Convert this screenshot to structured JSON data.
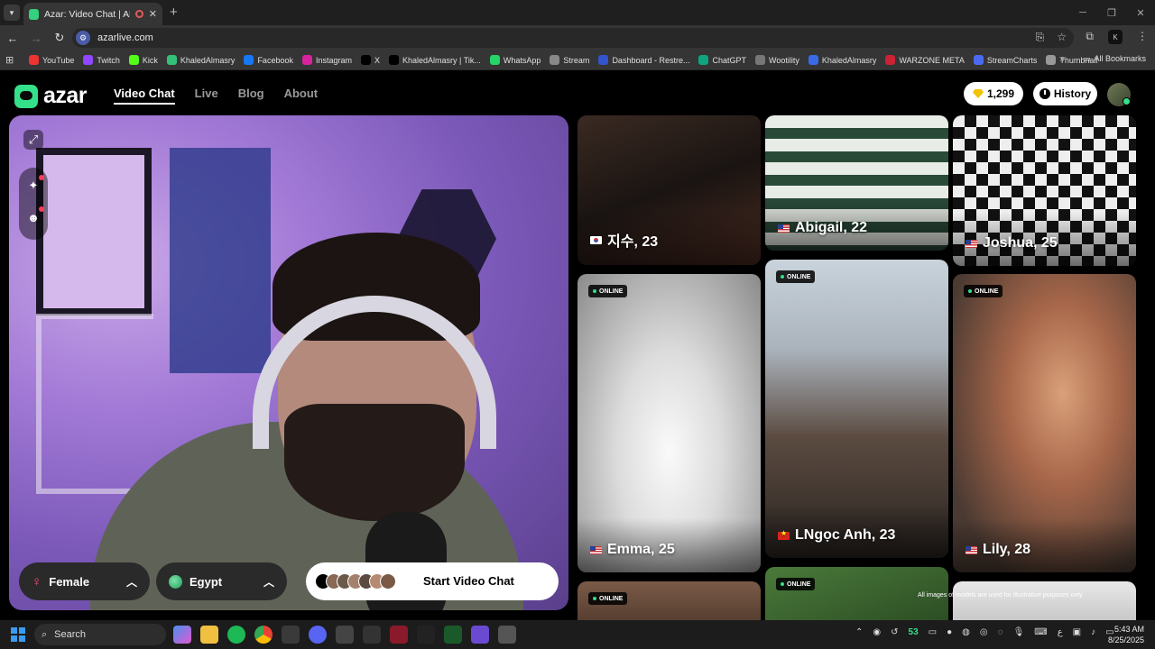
{
  "browser": {
    "tab_title": "Azar: Video Chat | Alternati",
    "url": "azarlive.com",
    "bookmarks": [
      "YouTube",
      "Twitch",
      "Kick",
      "KhaledAlmasry",
      "Facebook",
      "Instagram",
      "X",
      "KhaledAlmasry | Tik...",
      "WhatsApp",
      "Stream",
      "Dashboard - Restre...",
      "ChatGPT",
      "Wootility",
      "KhaledAlmasry",
      "WARZONE META",
      "StreamCharts",
      "Thumbnail"
    ],
    "all_bookmarks": "All Bookmarks"
  },
  "header": {
    "logo": "azar",
    "nav": [
      "Video Chat",
      "Live",
      "Blog",
      "About"
    ],
    "gems": "1,299",
    "history": "History"
  },
  "controls": {
    "gender": "Female",
    "country": "Egypt",
    "start": "Start Video Chat"
  },
  "profiles": [
    {
      "name": "지수, 23",
      "flag": "kr",
      "online": false
    },
    {
      "name": "Abigail, 22",
      "flag": "us",
      "online": false
    },
    {
      "name": "Joshua, 25",
      "flag": "us",
      "online": false
    },
    {
      "name": "Emma, 25",
      "flag": "us",
      "online": true
    },
    {
      "name": "LNgọc Anh, 23",
      "flag": "vn",
      "online": true
    },
    {
      "name": "Lily, 28",
      "flag": "us",
      "online": true
    }
  ],
  "online_label": "ONLINE",
  "disclaimer": "All images of models are used for illustrative purposes only.",
  "taskbar": {
    "search": "Search",
    "fps": "53",
    "time": "5:43 AM",
    "date": "8/25/2025"
  },
  "colors": {
    "accent": "#35e08a",
    "online_dot": "#35e08a",
    "gems": "#f2c200"
  }
}
